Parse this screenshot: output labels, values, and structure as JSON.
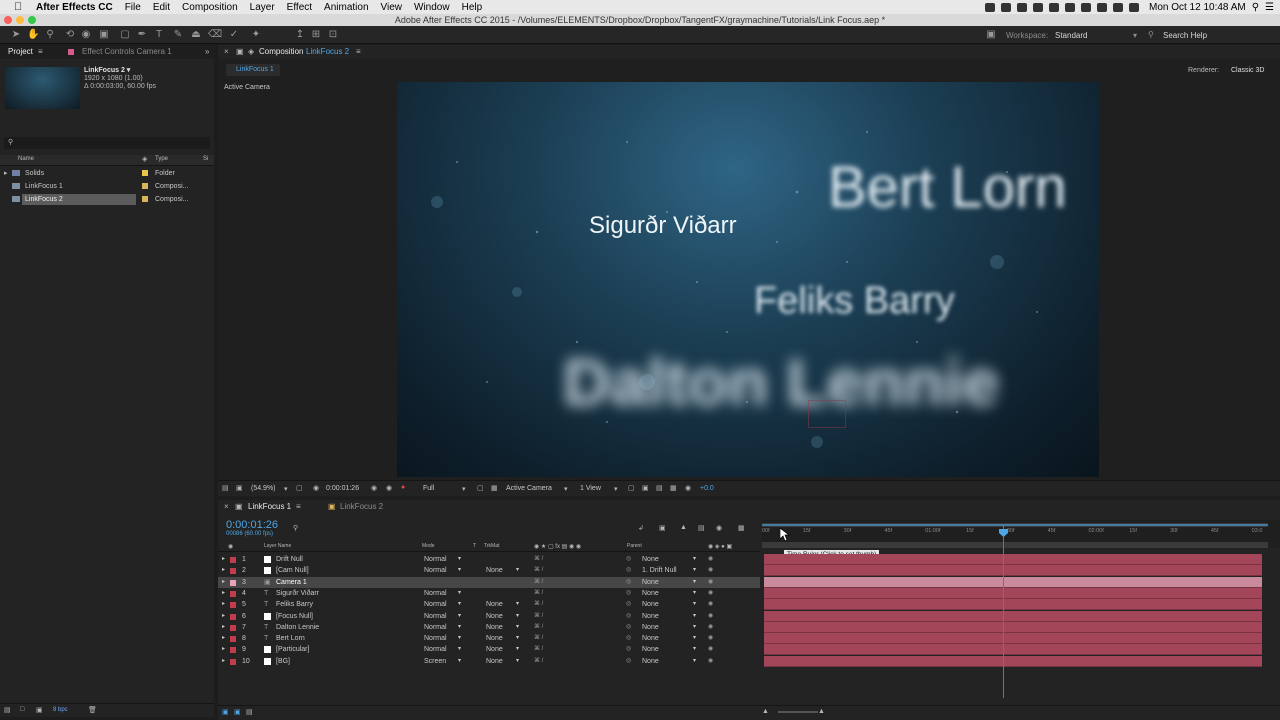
{
  "menubar": {
    "app_name": "After Effects CC",
    "items": [
      "File",
      "Edit",
      "Composition",
      "Layer",
      "Effect",
      "Animation",
      "View",
      "Window",
      "Help"
    ],
    "clock": "Mon Oct 12  10:48 AM"
  },
  "titlebar": {
    "title": "Adobe After Effects CC 2015 - /Volumes/ELEMENTS/Dropbox/Dropbox/TangentFX/graymachine/Tutorials/Link Focus.aep *"
  },
  "toolbar": {
    "workspace_label": "Workspace:",
    "workspace_value": "Standard",
    "search_help": "Search Help"
  },
  "project": {
    "tab_label": "Project",
    "effect_controls_label": "Effect Controls Camera 1",
    "comp_name": "LinkFocus 2 ▾",
    "comp_size": "1920 x 1080 (1.00)",
    "comp_duration": "Δ 0:00:03:00, 60.00 fps",
    "col_name": "Name",
    "col_type": "Type",
    "col_size": "Si",
    "items": [
      {
        "name": "Solids",
        "type": "Folder",
        "color": "#e8c547"
      },
      {
        "name": "LinkFocus 1",
        "type": "Composi...",
        "color": "#d9b45a"
      },
      {
        "name": "LinkFocus 2",
        "type": "Composi...",
        "color": "#d9b45a"
      }
    ],
    "bpc": "8 bpc"
  },
  "composition": {
    "tab_label": "Composition",
    "tab_comp": "LinkFocus 2",
    "breadcrumb": "LinkFocus 1",
    "renderer_label": "Renderer:",
    "renderer_value": "Classic 3D",
    "active_camera_label": "Active Camera",
    "viewer_names": [
      "Bert Lorn",
      "Sigurðr Viðarr",
      "Feliks Barry",
      "Dalton Lennie"
    ],
    "zoom": "(54.9%)",
    "timecode": "0:00:01:26",
    "resolution": "Full",
    "view_camera": "Active Camera",
    "view_count": "1 View",
    "exposure": "+0.0"
  },
  "timeline": {
    "tab1": "LinkFocus 1",
    "tab2": "LinkFocus 2",
    "timecode": "0:00:01:26",
    "frame_info": "00086 (60.00 fps)",
    "col_layer_name": "Layer Name",
    "col_mode": "Mode",
    "col_t": "T",
    "col_trkmat": "TrkMat",
    "col_parent": "Parent",
    "tooltip": "Time Ruler (Click to set thumb)",
    "ruler_labels": [
      "00f",
      "15f",
      "30f",
      "45f",
      "01:00f",
      "15f",
      "30f",
      "45f",
      "02:00f",
      "15f",
      "30f",
      "45f",
      "03:0"
    ],
    "layers": [
      {
        "num": "1",
        "name": "Drift Null",
        "mode": "Normal",
        "trkmat": "",
        "parent": "None",
        "color": "#c23c4b",
        "swatch": "#ffffff"
      },
      {
        "num": "2",
        "name": "[Cam Null]",
        "mode": "Normal",
        "trkmat": "None",
        "parent": "1. Drift Null",
        "color": "#c23c4b",
        "swatch": "#ffffff"
      },
      {
        "num": "3",
        "name": "Camera 1",
        "mode": "",
        "trkmat": "",
        "parent": "None",
        "color": "#e8a3b8",
        "swatch": ""
      },
      {
        "num": "4",
        "name": "Sigurðr Viðarr",
        "mode": "Normal",
        "trkmat": "",
        "parent": "None",
        "color": "#c23c4b",
        "swatch": ""
      },
      {
        "num": "5",
        "name": "Feliks Barry",
        "mode": "Normal",
        "trkmat": "None",
        "parent": "None",
        "color": "#c23c4b",
        "swatch": ""
      },
      {
        "num": "6",
        "name": "[Focus Null]",
        "mode": "Normal",
        "trkmat": "None",
        "parent": "None",
        "color": "#c23c4b",
        "swatch": "#ffffff"
      },
      {
        "num": "7",
        "name": "Dalton Lennie",
        "mode": "Normal",
        "trkmat": "None",
        "parent": "None",
        "color": "#c23c4b",
        "swatch": ""
      },
      {
        "num": "8",
        "name": "Bert Lorn",
        "mode": "Normal",
        "trkmat": "None",
        "parent": "None",
        "color": "#c23c4b",
        "swatch": ""
      },
      {
        "num": "9",
        "name": "[Particular]",
        "mode": "Normal",
        "trkmat": "None",
        "parent": "None",
        "color": "#c23c4b",
        "swatch": "#ffffff"
      },
      {
        "num": "10",
        "name": "[BG]",
        "mode": "Screen",
        "trkmat": "None",
        "parent": "None",
        "color": "#c23c4b",
        "swatch": "#ffffff"
      }
    ]
  }
}
